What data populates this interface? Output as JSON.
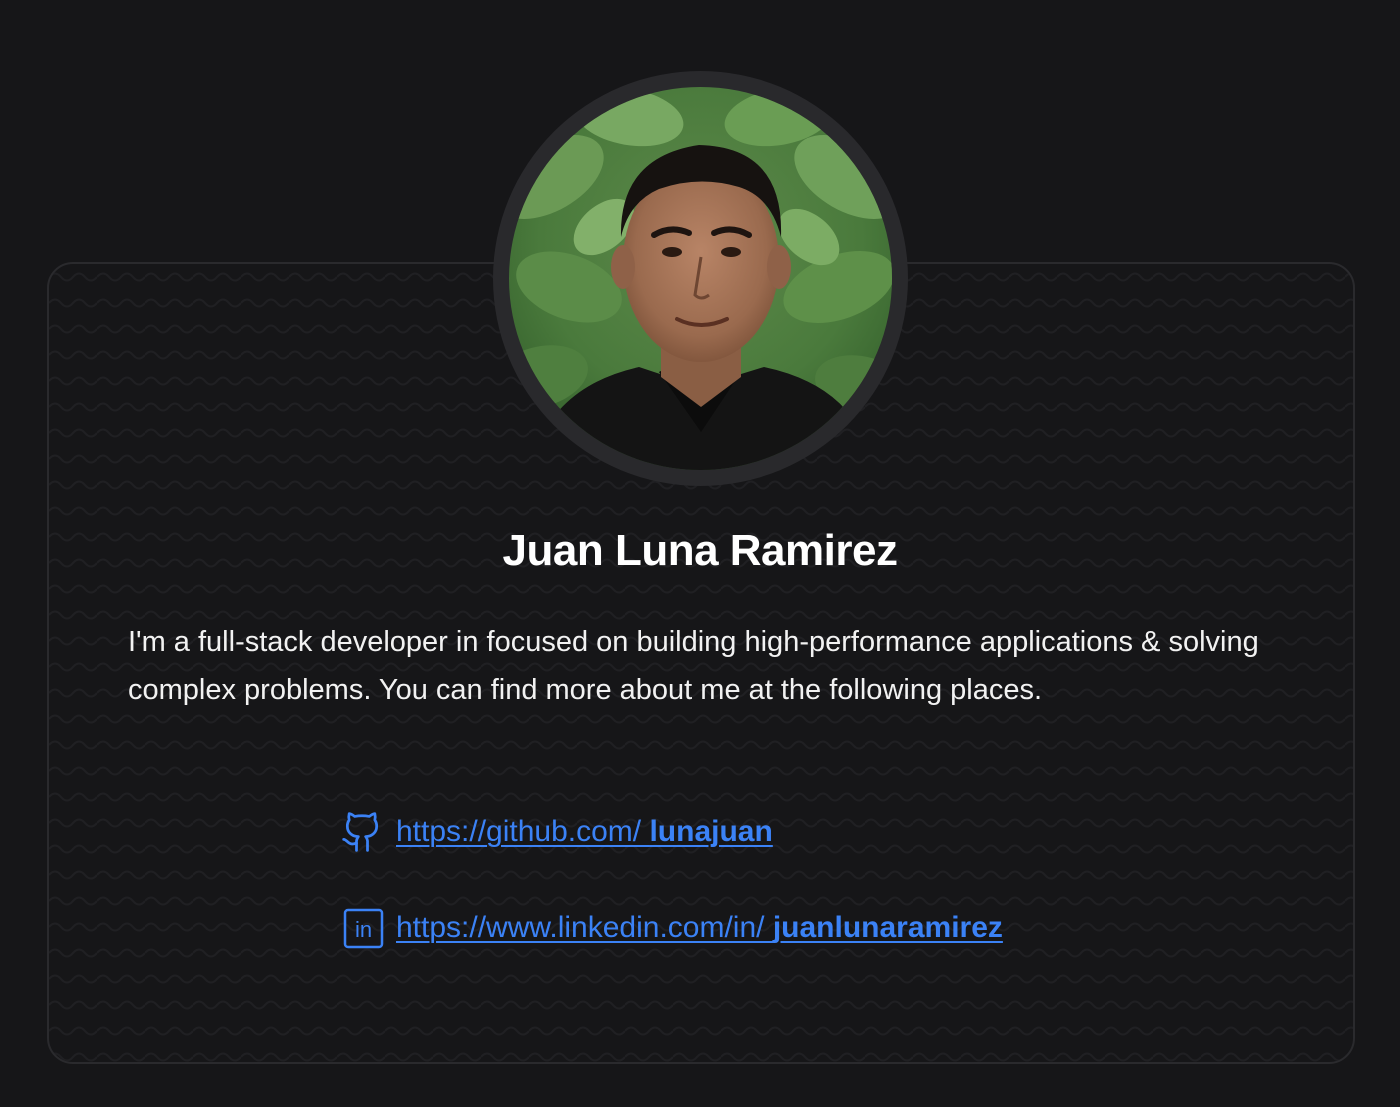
{
  "profile": {
    "name": "Juan Luna Ramirez",
    "avatar_alt": "photo-of-person",
    "bio": "I'm a full-stack developer in focused on building high-performance applications & solving complex problems. You can find more about me at the following places."
  },
  "links": {
    "github": {
      "icon": "github-icon",
      "prefix": "https://github.com/ ",
      "handle": "lunajuan"
    },
    "linkedin": {
      "icon": "linkedin-icon",
      "prefix": "https://www.linkedin.com/in/ ",
      "handle": "juanlunaramirez"
    }
  },
  "colors": {
    "background": "#161618",
    "card_border": "#2a2a2d",
    "link": "#3b82f6",
    "text": "#ffffff"
  }
}
